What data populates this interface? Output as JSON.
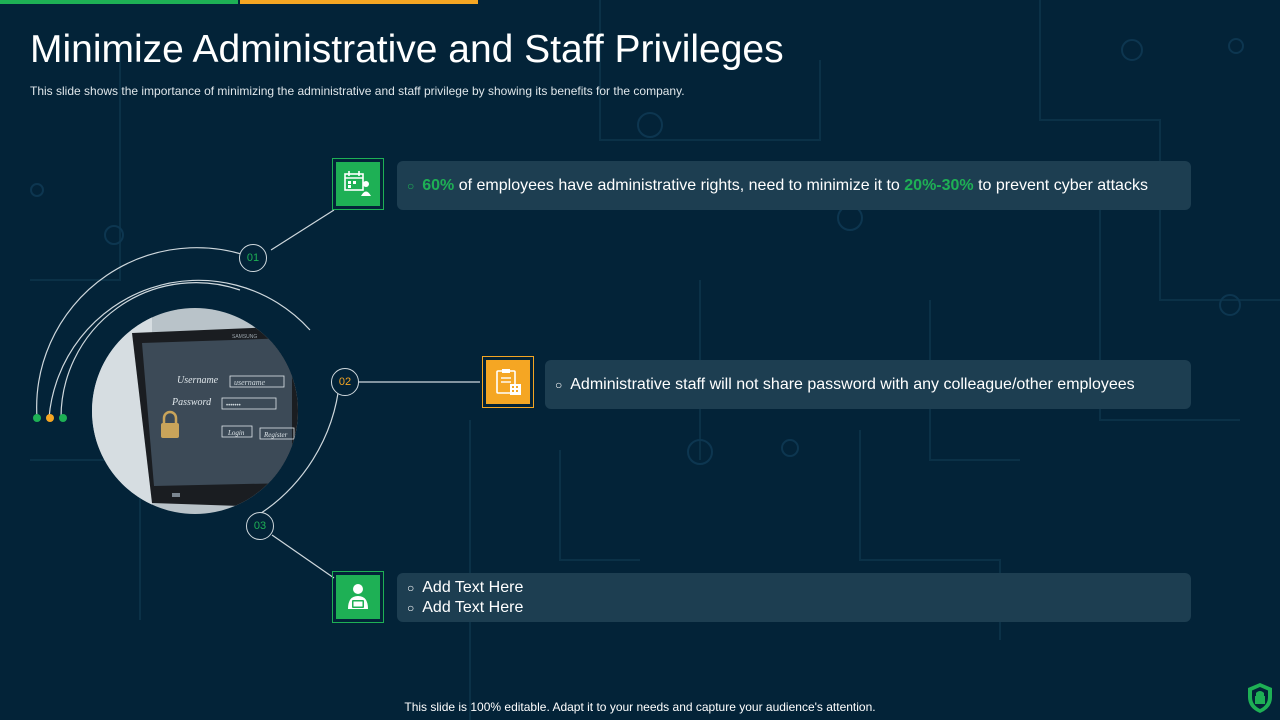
{
  "slide": {
    "title": "Minimize Administrative and Staff Privileges",
    "subtitle": "This slide shows the importance of minimizing the administrative and staff privilege  by showing its benefits for the company.",
    "footer": "This slide is 100% editable. Adapt it to your needs and capture your audience's attention."
  },
  "colors": {
    "background": "#032338",
    "green": "#1eb055",
    "orange": "#f5a623",
    "card": "#1d3e51"
  },
  "steps": [
    {
      "number": "01",
      "icon": "calendar-user-icon",
      "text_part1": "60%",
      "text_part2": " of employees have administrative rights, need to minimize it to ",
      "text_part3": "20%-30%",
      "text_part4": " to prevent cyber attacks"
    },
    {
      "number": "02",
      "icon": "clipboard-calculator-icon",
      "text": "Administrative staff will not share password with any colleague/other employees"
    },
    {
      "number": "03",
      "icon": "user-laptop-icon",
      "line1": "Add Text Here",
      "line2": "Add Text Here"
    }
  ],
  "photo": {
    "username_label": "Username",
    "username_field": "username",
    "password_label": "Password",
    "password_field": "•••••••",
    "login": "Login",
    "register": "Register",
    "brand": "SAMSUNG"
  }
}
